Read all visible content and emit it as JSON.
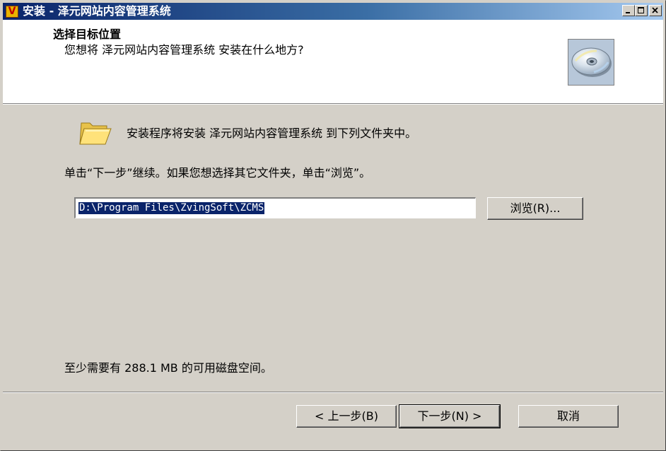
{
  "window": {
    "title": "安装 - 泽元网站内容管理系统",
    "app_icon_glyph": "V"
  },
  "header": {
    "title": "选择目标位置",
    "subtitle": "您想将 泽元网站内容管理系统 安装在什么地方?",
    "icon": "cd-disc-icon"
  },
  "body": {
    "folder_icon": "folder-icon",
    "info_line": "安装程序将安装 泽元网站内容管理系统 到下列文件夹中。",
    "instruction_line": "单击“下一步”继续。如果您想选择其它文件夹，单击“浏览”。",
    "install_path": "D:\\Program Files\\ZvingSoft\\ZCMS",
    "browse_label": "浏览(R)...",
    "disk_space_line": "至少需要有 288.1 MB 的可用磁盘空间。"
  },
  "footer": {
    "back_label": "< 上一步(B)",
    "next_label": "下一步(N) >",
    "cancel_label": "取消"
  }
}
